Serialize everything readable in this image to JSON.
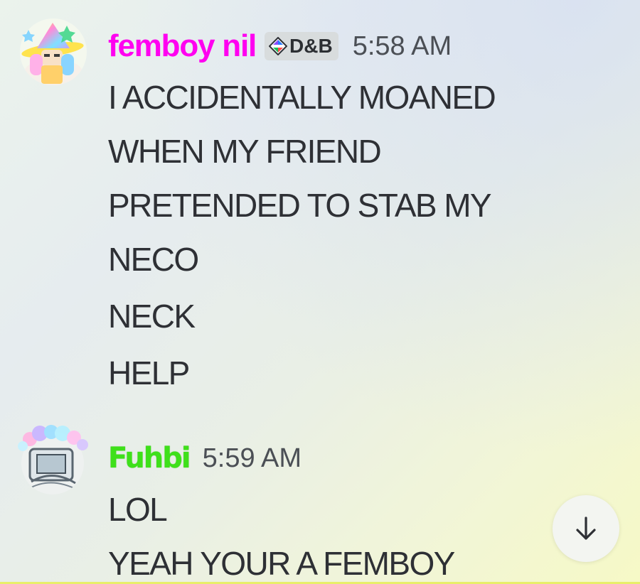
{
  "messages": [
    {
      "username": "femboy nil",
      "username_color": "#ff00f0",
      "role_tag": "D&B",
      "timestamp": "5:58 AM",
      "lines": [
        "I ACCIDENTALLY MOANED",
        "WHEN MY FRIEND",
        "PRETENDED TO STAB MY",
        "NECO",
        "NECK",
        "HELP"
      ]
    },
    {
      "username": "Fuhbi",
      "username_color": "#3ee01a",
      "timestamp": "5:59 AM",
      "lines": [
        "LOL",
        "YEAH YOUR A FEMBOY"
      ]
    }
  ],
  "scroll_button": {
    "icon": "arrow-down-icon"
  },
  "colors": {
    "message_text": "#2e3035",
    "timestamp": "#4b4f55",
    "role_tag_bg": "#d8dcdd"
  }
}
